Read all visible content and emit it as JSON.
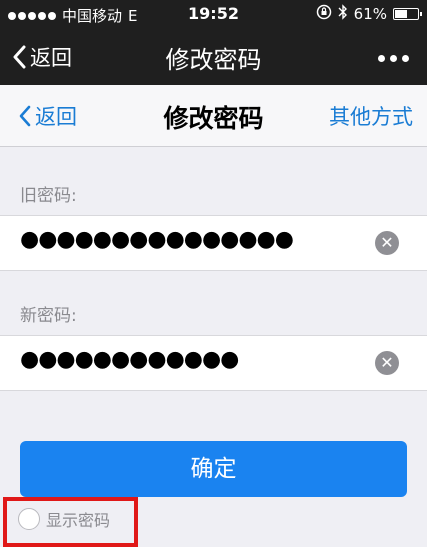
{
  "status_bar": {
    "carrier": "中国移动",
    "network": "E",
    "time": "19:52",
    "battery": "61%",
    "battery_level": 0.61
  },
  "app_nav": {
    "back_label": "返回",
    "title": "修改密码",
    "more_icon": "more-icon"
  },
  "page_nav": {
    "back_label": "返回",
    "title": "修改密码",
    "alt_method_label": "其他方式"
  },
  "form": {
    "old_password_label": "旧密码:",
    "old_password_value": "●●●●●●●●●●●●●●●",
    "new_password_label": "新密码:",
    "new_password_value": "●●●●●●●●●●●●"
  },
  "confirm_label": "确定",
  "show_password_label": "显示密码",
  "colors": {
    "accent": "#1a7cd4",
    "button": "#1a83f0",
    "highlight": "#e01818"
  }
}
